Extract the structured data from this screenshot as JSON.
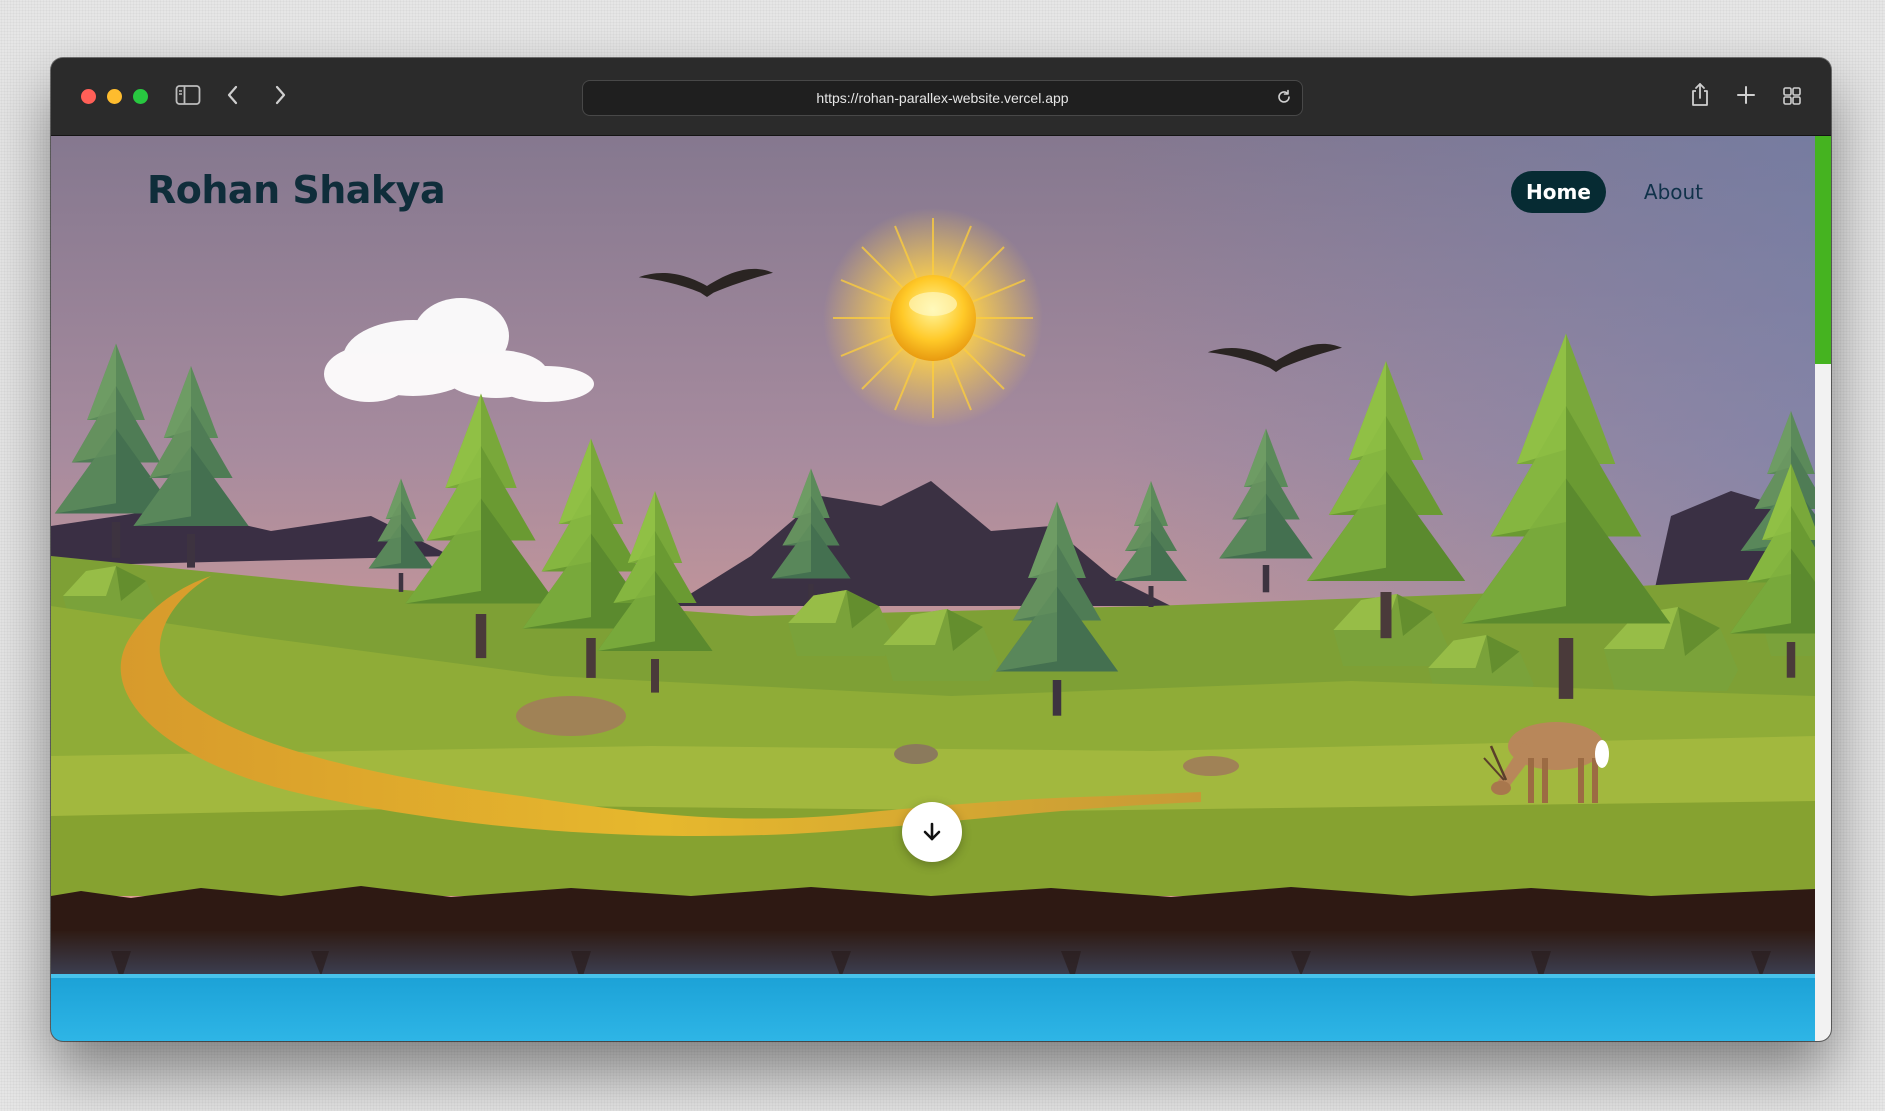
{
  "browser": {
    "url": "https://rohan-parallex-website.vercel.app",
    "traffic_lights": [
      "#ff5f57",
      "#febc2e",
      "#28c840"
    ],
    "toolbar_icons": [
      "sidebar-icon",
      "back-icon",
      "forward-icon",
      "reload-icon",
      "share-icon",
      "new-tab-icon",
      "tab-overview-icon"
    ]
  },
  "site": {
    "title": "Rohan Shakya",
    "nav": [
      {
        "label": "Home",
        "active": true
      },
      {
        "label": "About",
        "active": false
      }
    ],
    "scroll_button_icon": "arrow-down-icon"
  },
  "colors": {
    "title": "#0f2d3a",
    "nav_active_bg": "#062b33",
    "scrollbar_thumb": "#45b320",
    "water": "#1da6d8"
  }
}
